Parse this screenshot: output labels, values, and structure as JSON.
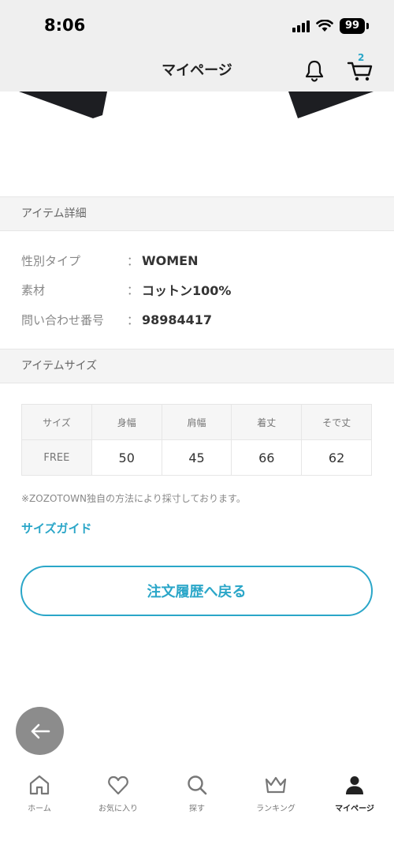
{
  "status_bar": {
    "time": "8:06",
    "battery": "99"
  },
  "header": {
    "title": "マイページ",
    "cart_count": "2"
  },
  "item_details": {
    "section_title": "アイテム詳細",
    "rows": [
      {
        "label": "性別タイプ",
        "colon": "：",
        "value": "WOMEN"
      },
      {
        "label": "素材",
        "colon": "：",
        "value": "コットン100%"
      },
      {
        "label": "問い合わせ番号",
        "colon": "：",
        "value": "98984417"
      }
    ]
  },
  "item_size": {
    "section_title": "アイテムサイズ",
    "headers": [
      "サイズ",
      "身幅",
      "肩幅",
      "着丈",
      "そで丈"
    ],
    "rows": [
      {
        "size": "FREE",
        "values": [
          "50",
          "45",
          "66",
          "62"
        ]
      }
    ],
    "note": "※ZOZOTOWN独自の方法により採寸しております。",
    "size_guide": "サイズガイド"
  },
  "back_button": "注文履歴へ戻る",
  "tabbar": {
    "tabs": [
      {
        "label": "ホーム",
        "icon": "home-icon",
        "active": false
      },
      {
        "label": "お気に入り",
        "icon": "heart-icon",
        "active": false
      },
      {
        "label": "探す",
        "icon": "search-icon",
        "active": false
      },
      {
        "label": "ランキング",
        "icon": "crown-icon",
        "active": false
      },
      {
        "label": "マイページ",
        "icon": "person-icon",
        "active": true
      }
    ]
  },
  "colors": {
    "accent": "#2aa6c8",
    "header_bg": "#efefef",
    "section_bg": "#f4f4f4"
  }
}
